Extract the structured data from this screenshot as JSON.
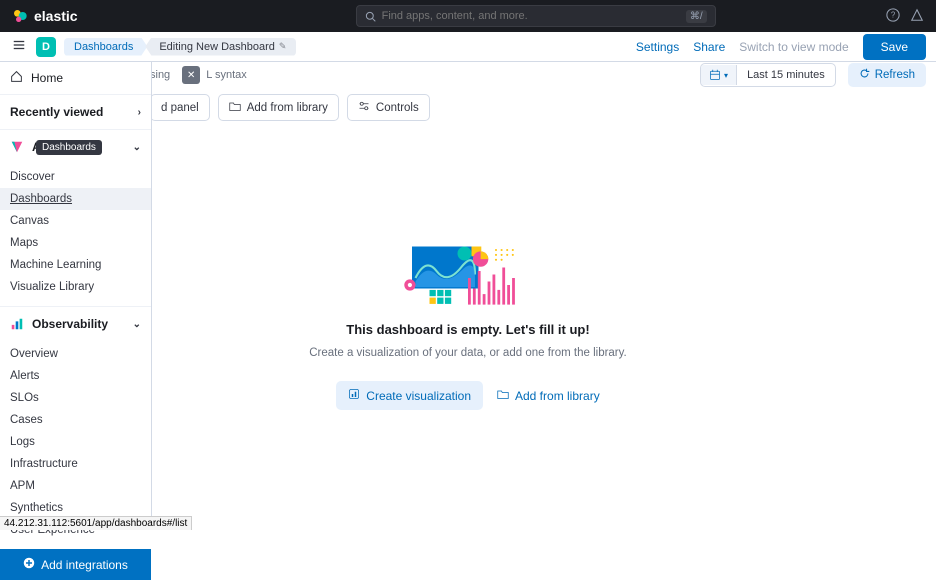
{
  "header": {
    "brand": "elastic",
    "search_placeholder": "Find apps, content, and more.",
    "shortcut": "⌘/"
  },
  "subheader": {
    "avatar_letter": "D",
    "breadcrumb_link": "Dashboards",
    "breadcrumb_current": "Editing New Dashboard",
    "settings": "Settings",
    "share": "Share",
    "switch_mode": "Switch to view mode",
    "save": "Save"
  },
  "sidebar": {
    "home": "Home",
    "recently_viewed": "Recently viewed",
    "analytics": {
      "label": "Analytics",
      "items": [
        "Discover",
        "Dashboards",
        "Canvas",
        "Maps",
        "Machine Learning",
        "Visualize Library"
      ]
    },
    "observability": {
      "label": "Observability",
      "items": [
        "Overview",
        "Alerts",
        "SLOs",
        "Cases",
        "Logs",
        "Infrastructure",
        "APM",
        "Synthetics",
        "User Experience"
      ]
    },
    "tooltip": "Dashboards",
    "add_integrations": "Add integrations"
  },
  "toolbar": {
    "query_hint_suffix": "L syntax",
    "query_hint_prefix": "sing",
    "time_range": "Last 15 minutes",
    "refresh": "Refresh",
    "add_panel_suffix": "d panel",
    "add_from_library": "Add from library",
    "controls": "Controls"
  },
  "empty": {
    "title": "This dashboard is empty. Let's fill it up!",
    "subtitle": "Create a visualization of your data, or add one from the library.",
    "create_vis": "Create visualization",
    "add_from_library": "Add from library"
  },
  "status_url": "44.212.31.112:5601/app/dashboards#/list"
}
